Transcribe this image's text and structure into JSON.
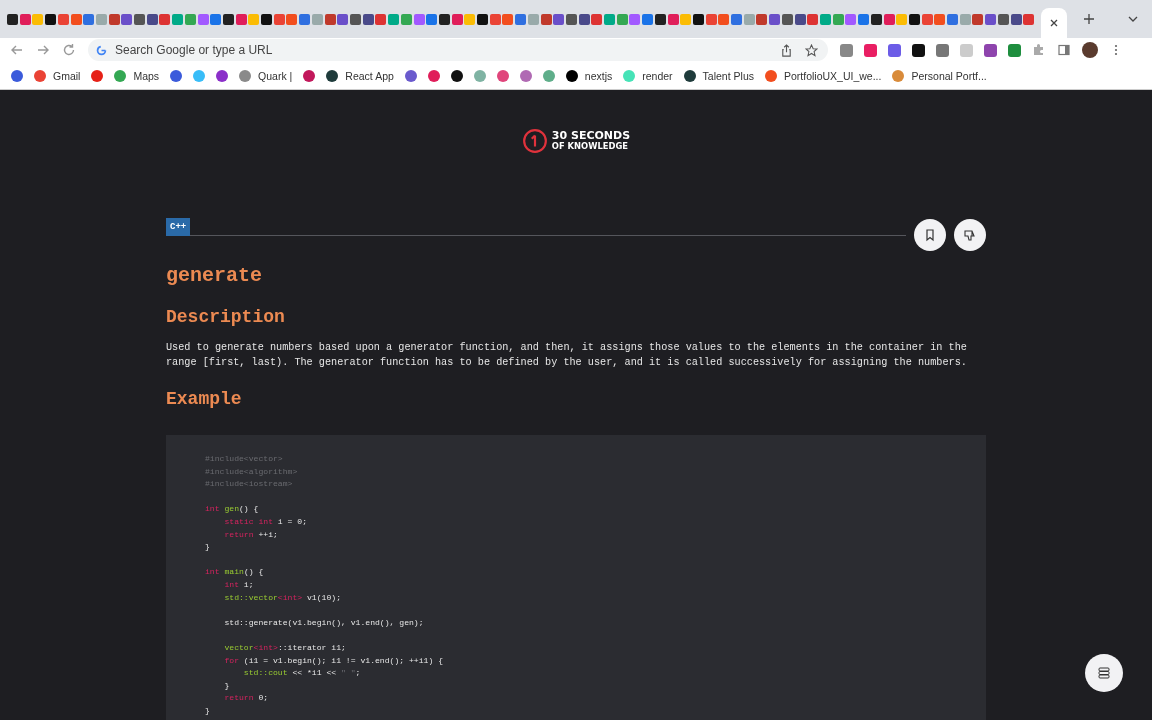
{
  "browser": {
    "address_placeholder": "Search Google or type a URL",
    "bookmarks": [
      {
        "color": "#3b5bdb"
      },
      {
        "label": "Gmail",
        "color": "#ea4335"
      },
      {
        "color": "#e62117"
      },
      {
        "label": "Maps",
        "color": "#34a853"
      },
      {
        "color": "#3b5bdb"
      },
      {
        "color": "#38bdf8"
      },
      {
        "color": "#8b2fc9"
      },
      {
        "label": "Quark |",
        "color": "#8a8a8a"
      },
      {
        "color": "#c2185b"
      },
      {
        "label": "React App",
        "color": "#1f3b3b"
      },
      {
        "color": "#6a5acd"
      },
      {
        "color": "#e01e5a"
      },
      {
        "color": "#111111"
      },
      {
        "color": "#7fb3a3"
      },
      {
        "color": "#e0457b"
      },
      {
        "color": "#b06ab3"
      },
      {
        "color": "#5fae8a"
      },
      {
        "label": "nextjs",
        "color": "#000000"
      },
      {
        "label": "render",
        "color": "#46e3b7"
      },
      {
        "label": "Talent Plus",
        "color": "#1f3b3b"
      },
      {
        "label": "PortfolioUX_UI_we...",
        "color": "#f24e1e"
      },
      {
        "label": "Personal Portf...",
        "color": "#d98b3a"
      }
    ]
  },
  "page": {
    "logo_line_1": "30 SECONDS",
    "logo_line_2": "OF KNOWLEDGE",
    "tag": "C++",
    "title": "generate",
    "description_heading": "Description",
    "description": "Used to generate numbers based upon a generator function, and then, it assigns those values to the elements in the container in the range [first, last). The generator function has to be defined by the user, and it is called successively for assigning the numbers.",
    "example_heading": "Example",
    "code_blocks": [
      [
        [
          {
            "text": "#include<vector>",
            "kind": "pp"
          }
        ],
        [
          {
            "text": "#include<algorithm>",
            "kind": "pp"
          }
        ],
        [
          {
            "text": "#include<iostream>",
            "kind": "pp"
          }
        ]
      ],
      [
        [
          {
            "text": "int ",
            "kind": "kw"
          },
          {
            "text": "gen",
            "kind": "fn"
          },
          {
            "text": "() {",
            "kind": "plain"
          }
        ],
        [
          {
            "text": "    static int",
            "kind": "kw"
          },
          {
            "text": " i = 0;",
            "kind": "plain"
          }
        ],
        [
          {
            "text": "    return",
            "kind": "kw"
          },
          {
            "text": " ++i;",
            "kind": "plain"
          }
        ],
        [
          {
            "text": "}",
            "kind": "plain"
          }
        ]
      ],
      [
        [
          {
            "text": "int ",
            "kind": "kw"
          },
          {
            "text": "main",
            "kind": "fn"
          },
          {
            "text": "() {",
            "kind": "plain"
          }
        ],
        [
          {
            "text": "    int",
            "kind": "kw"
          },
          {
            "text": " i;",
            "kind": "plain"
          }
        ],
        [
          {
            "text": "    std::vector",
            "kind": "fn"
          },
          {
            "text": "<int>",
            "kind": "kw"
          },
          {
            "text": " v1(10);",
            "kind": "plain"
          }
        ]
      ],
      [
        [
          {
            "text": "    std::generate(v1.begin(), v1.end(), gen);",
            "kind": "plain"
          }
        ]
      ],
      [
        [
          {
            "text": "    vector",
            "kind": "fn"
          },
          {
            "text": "<int>",
            "kind": "kw"
          },
          {
            "text": "::iterator i1;",
            "kind": "plain"
          }
        ],
        [
          {
            "text": "    for",
            "kind": "kw"
          },
          {
            "text": " (i1 = v1.begin(); i1 != v1.end(); ++i1) {",
            "kind": "plain"
          }
        ],
        [
          {
            "text": "        std::cout",
            "kind": "fn"
          },
          {
            "text": " << *i1 << ",
            "kind": "plain"
          },
          {
            "text": "\" \"",
            "kind": "pp"
          },
          {
            "text": ";",
            "kind": "plain"
          }
        ],
        [
          {
            "text": "    }",
            "kind": "plain"
          }
        ],
        [
          {
            "text": "    return",
            "kind": "kw"
          },
          {
            "text": " 0;",
            "kind": "plain"
          }
        ],
        [
          {
            "text": "}",
            "kind": "plain"
          }
        ]
      ]
    ]
  }
}
